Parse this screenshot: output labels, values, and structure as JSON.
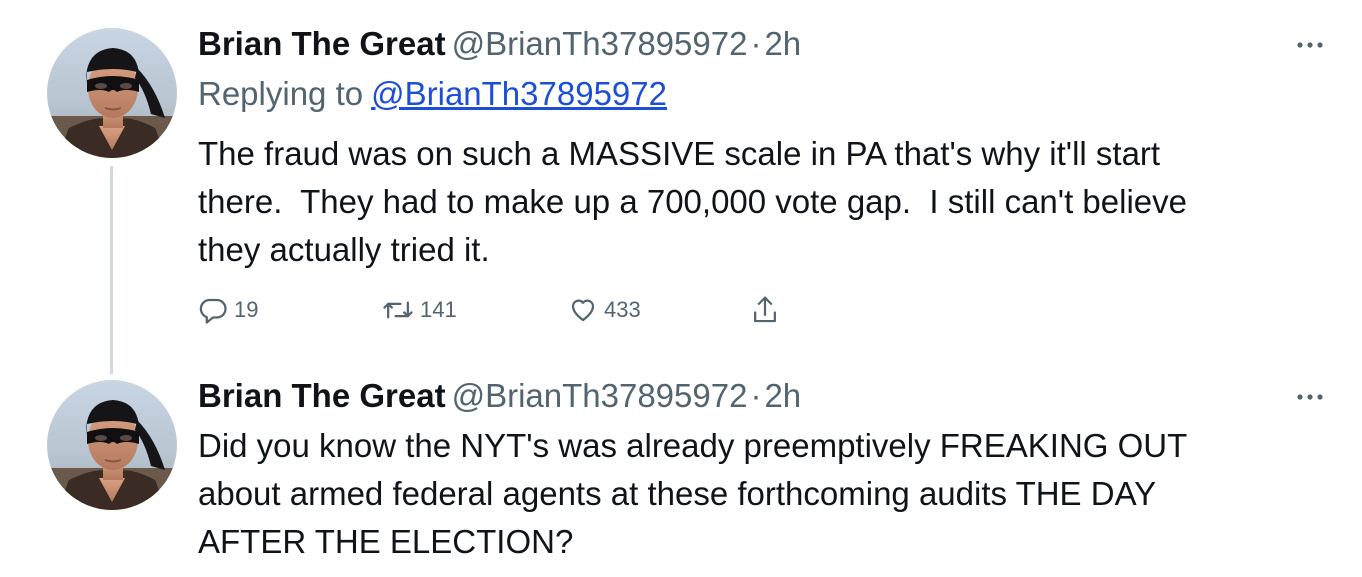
{
  "tweets": [
    {
      "author": {
        "name": "Brian The Great",
        "handle": "@BrianTh37895972",
        "avatar_icon": "masked-man-avatar"
      },
      "separator": "·",
      "time": "2h",
      "replying_label": "Replying to",
      "replying_handle": "@BrianTh37895972",
      "text": "The fraud was on such a MASSIVE scale in PA that's why it'll start\nthere.  They had to make up a 700,000 vote gap.  I still can't believe\nthey actually tried it.",
      "stats": {
        "replies": "19",
        "retweets": "141",
        "likes": "433"
      },
      "icons": {
        "reply": "reply-icon",
        "retweet": "retweet-icon",
        "like": "heart-icon",
        "share": "share-icon",
        "more": "more-icon"
      }
    },
    {
      "author": {
        "name": "Brian The Great",
        "handle": "@BrianTh37895972",
        "avatar_icon": "masked-man-avatar"
      },
      "separator": "·",
      "time": "2h",
      "text": "Did you know the NYT's was already preemptively FREAKING OUT\nabout armed federal agents at these forthcoming audits THE DAY\nAFTER THE ELECTION?",
      "icons": {
        "more": "more-icon"
      }
    }
  ],
  "colors": {
    "text": "#0f1419",
    "secondary": "#536471",
    "link": "#1d4ed8",
    "thread_line": "#cfd9de"
  }
}
